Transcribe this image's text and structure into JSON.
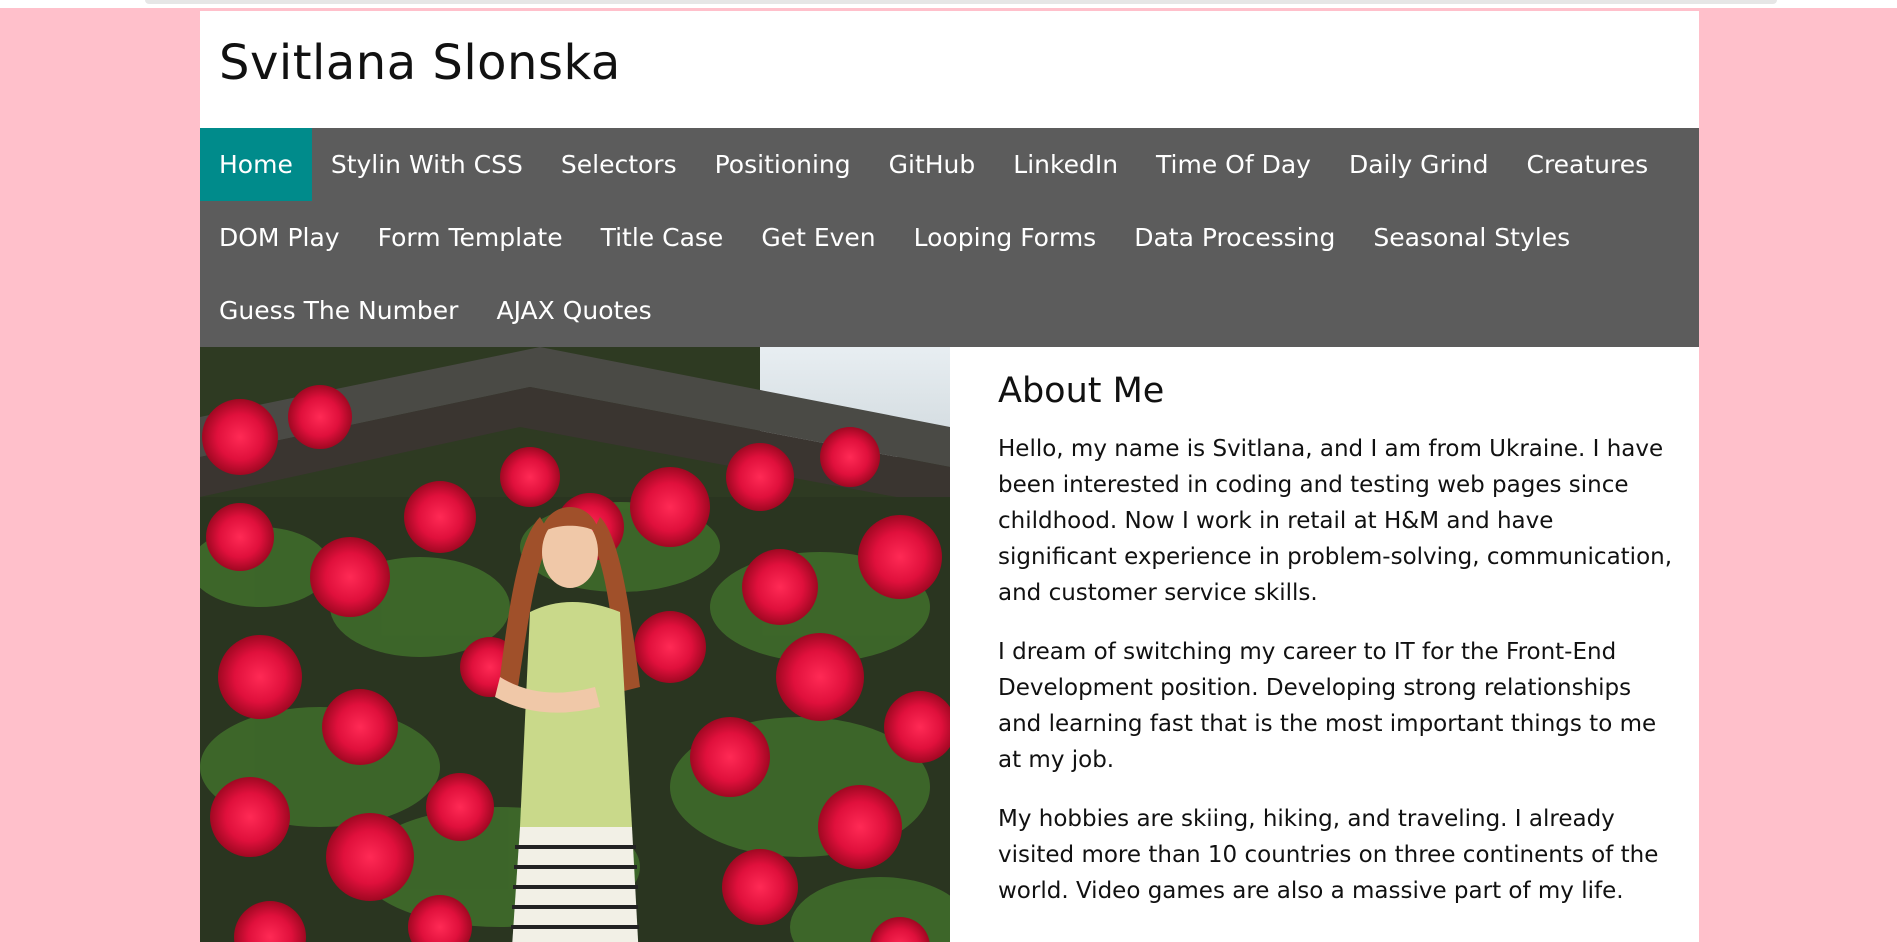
{
  "site": {
    "title": "Svitlana Slonska"
  },
  "nav": {
    "items": [
      {
        "label": "Home",
        "active": true
      },
      {
        "label": "Stylin With CSS"
      },
      {
        "label": "Selectors"
      },
      {
        "label": "Positioning"
      },
      {
        "label": "GitHub"
      },
      {
        "label": "LinkedIn"
      },
      {
        "label": "Time Of Day"
      },
      {
        "label": "Daily Grind"
      },
      {
        "label": "Creatures"
      },
      {
        "label": "DOM Play"
      },
      {
        "label": "Form Template"
      },
      {
        "label": "Title Case"
      },
      {
        "label": "Get Even"
      },
      {
        "label": "Looping Forms"
      },
      {
        "label": "Data Processing"
      },
      {
        "label": "Seasonal Styles"
      },
      {
        "label": "Guess The Number"
      },
      {
        "label": "AJAX Quotes"
      }
    ]
  },
  "about": {
    "heading": "About Me",
    "paragraphs": [
      "Hello, my name is Svitlana, and I am from Ukraine. I have been interested in coding and testing web pages since childhood. Now I work in retail at H&M and have significant experience in problem-solving, communication, and customer service skills.",
      "I dream of switching my career to IT for the Front-End Development position. Developing strong relationships and learning fast that is the most important things to me at my job.",
      "My hobbies are skiing, hiking, and traveling. I already visited more than 10 countries on three continents of the world. Video games are also a massive part of my life."
    ]
  },
  "colors": {
    "page_background": "#ffc0cb",
    "nav_background": "#5c5c5c",
    "nav_active": "#008b8b"
  }
}
